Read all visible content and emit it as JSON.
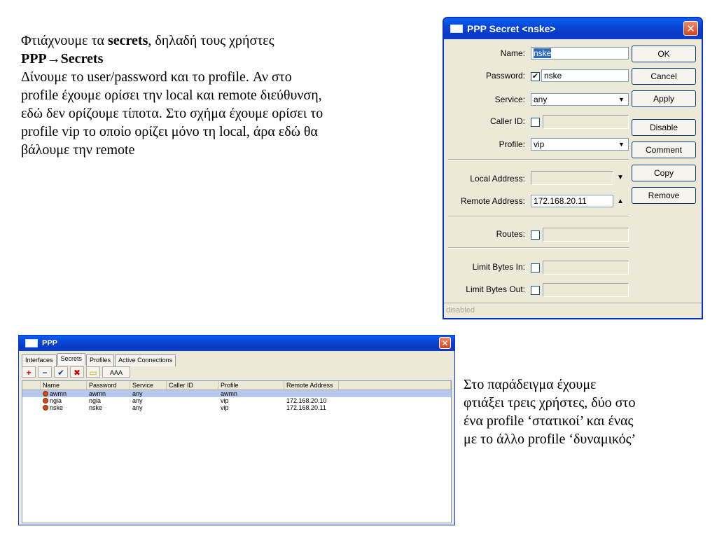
{
  "slide": {
    "top_paragraph": {
      "line1_prefix": "Φτιάχνουμε τα ",
      "line1_bold": "secrets",
      "line1_suffix": ", δηλαδή τους χρήστες",
      "line2_bold": "PPP→Secrets",
      "line3": "Δίνουμε το user/password και το profile. Αν στο",
      "line4": "profile έχουμε ορίσει την local και remote διεύθυνση,",
      "line5": "εδώ δεν ορίζουμε τίποτα. Στο σχήμα έχουμε ορίσει το",
      "line6": "profile vip το οποίο ορίζει μόνο τη local, άρα εδώ θα",
      "line7": "βάλουμε την remote"
    },
    "bottom_paragraph": {
      "line1": "Στο παράδειγμα έχουμε",
      "line2": "φτιάξει τρεις χρήστες, δύο στο",
      "line3": "ένα profile ‘στατικοί’ και ένας",
      "line4": "με το άλλο profile ‘δυναμικός’"
    }
  },
  "secret_dialog": {
    "title": "PPP Secret <nske>",
    "close_glyph": "✕",
    "fields": {
      "name_label": "Name:",
      "name_value": "nske",
      "password_label": "Password:",
      "password_value": "nske",
      "password_checked": "✔",
      "service_label": "Service:",
      "service_value": "any",
      "caller_id_label": "Caller ID:",
      "profile_label": "Profile:",
      "profile_value": "vip",
      "local_address_label": "Local Address:",
      "remote_address_label": "Remote Address:",
      "remote_address_value": "172.168.20.11",
      "routes_label": "Routes:",
      "limit_in_label": "Limit Bytes In:",
      "limit_out_label": "Limit Bytes Out:"
    },
    "buttons": {
      "ok": "OK",
      "cancel": "Cancel",
      "apply": "Apply",
      "disable": "Disable",
      "comment": "Comment",
      "copy": "Copy",
      "remove": "Remove"
    },
    "status": "disabled"
  },
  "ppp_window": {
    "title": "PPP",
    "close_glyph": "✕",
    "tabs": [
      "Interfaces",
      "Secrets",
      "Profiles",
      "Active Connections"
    ],
    "toolbar": {
      "add": "+",
      "remove": "−",
      "enable": "✔",
      "disable": "✖",
      "comment": "▭",
      "filter": "AAA"
    },
    "columns": [
      "Name",
      "Password",
      "Service",
      "Caller ID",
      "Profile",
      "Remote Address"
    ],
    "rows": [
      {
        "name": "awmn",
        "password": "awmn",
        "service": "any",
        "caller_id": "",
        "profile": "awmn",
        "remote": ""
      },
      {
        "name": "ngia",
        "password": "ngia",
        "service": "any",
        "caller_id": "",
        "profile": "vip",
        "remote": "172.168.20.10"
      },
      {
        "name": "nske",
        "password": "nske",
        "service": "any",
        "caller_id": "",
        "profile": "vip",
        "remote": "172.168.20.11"
      }
    ]
  },
  "colors": {
    "titlebar": "#0a46d6",
    "dialog_bg": "#ece9d8",
    "selected_row": "#b5c8ee",
    "close_button": "#d6431f"
  }
}
